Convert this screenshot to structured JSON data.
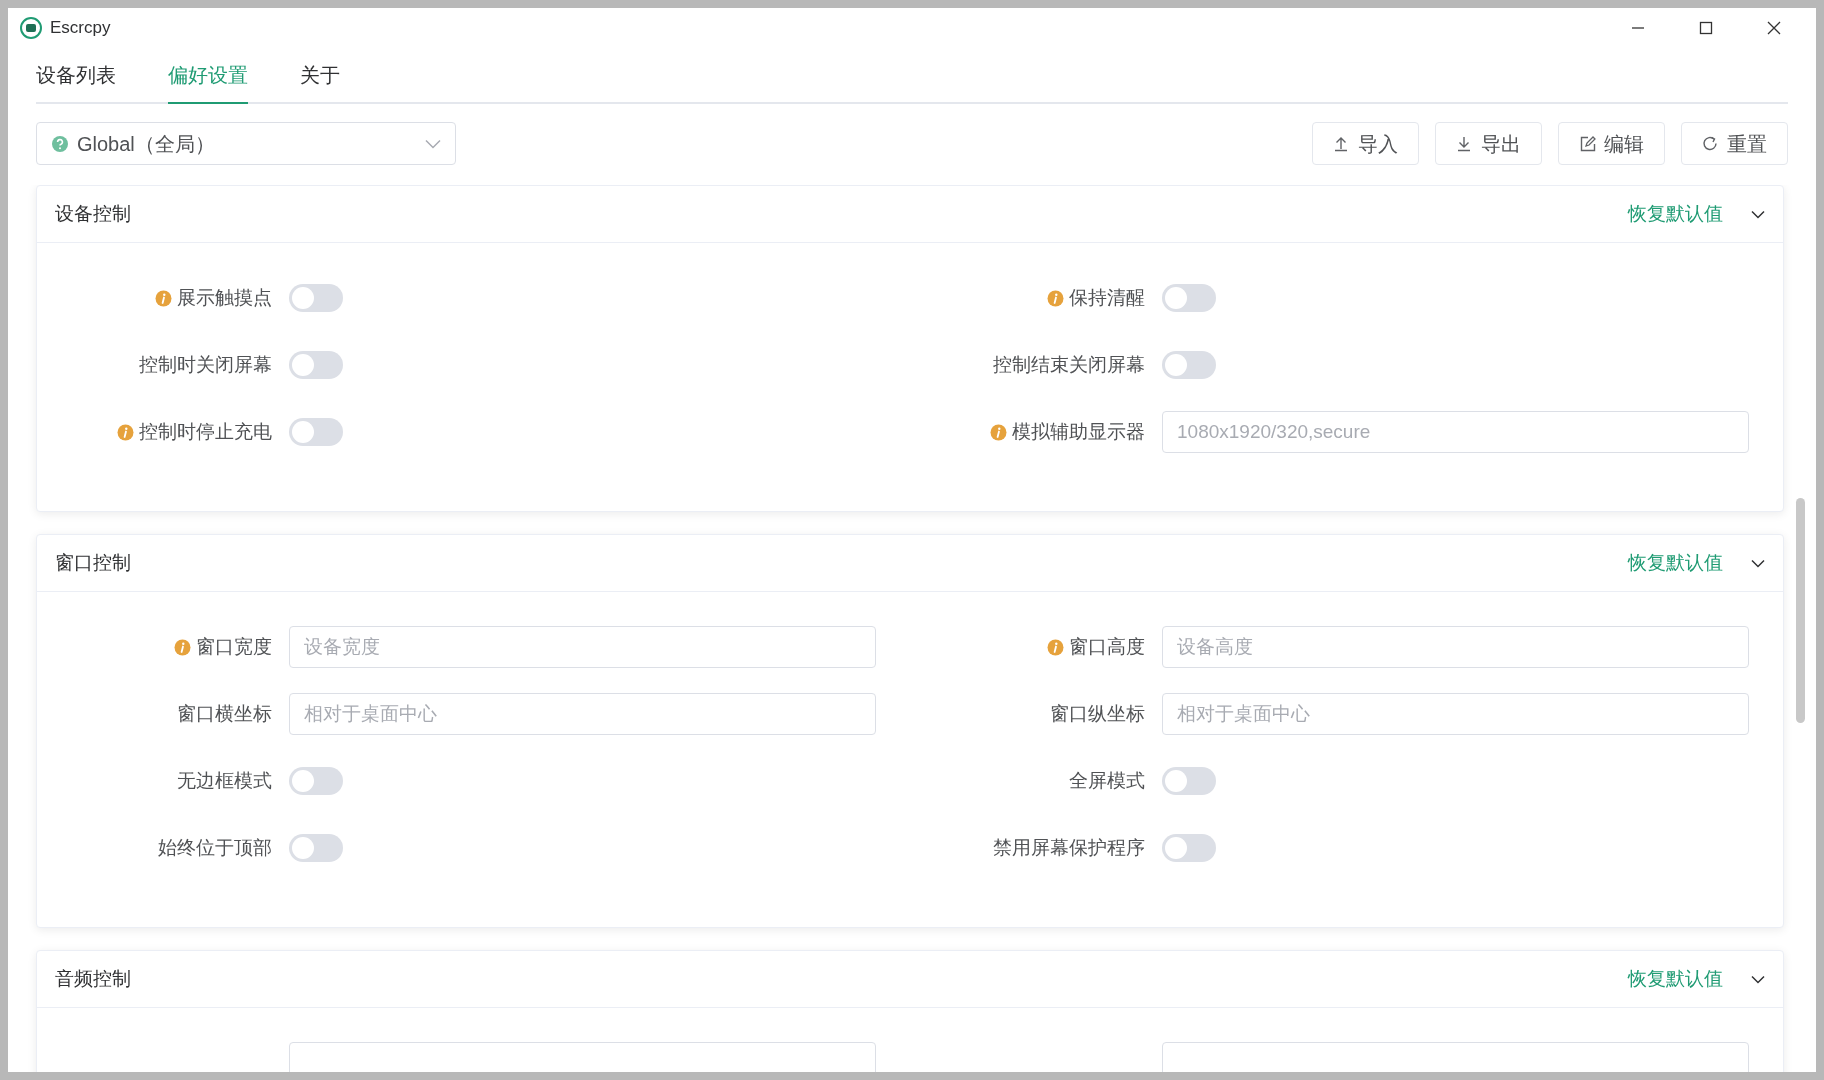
{
  "window": {
    "title": "Escrcpy"
  },
  "tabs": [
    {
      "label": "设备列表",
      "selected": false
    },
    {
      "label": "偏好设置",
      "selected": true
    },
    {
      "label": "关于",
      "selected": false
    }
  ],
  "scope_select": {
    "value": "Global（全局）"
  },
  "toolbar_buttons": [
    {
      "kind": "import",
      "label": "导入"
    },
    {
      "kind": "export",
      "label": "导出"
    },
    {
      "kind": "edit",
      "label": "编辑"
    },
    {
      "kind": "reset",
      "label": "重置"
    }
  ],
  "sections": [
    {
      "title": "设备控制",
      "reset_label": "恢复默认值",
      "items": [
        {
          "kind": "switch",
          "label": "展示触摸点",
          "info": true,
          "on": false
        },
        {
          "kind": "switch",
          "label": "保持清醒",
          "info": true,
          "on": false
        },
        {
          "kind": "switch",
          "label": "控制时关闭屏幕",
          "info": false,
          "on": false
        },
        {
          "kind": "switch",
          "label": "控制结束关闭屏幕",
          "info": false,
          "on": false
        },
        {
          "kind": "switch",
          "label": "控制时停止充电",
          "info": true,
          "on": false
        },
        {
          "kind": "input",
          "label": "模拟辅助显示器",
          "info": true,
          "placeholder": "1080x1920/320,secure"
        }
      ]
    },
    {
      "title": "窗口控制",
      "reset_label": "恢复默认值",
      "items": [
        {
          "kind": "input",
          "label": "窗口宽度",
          "info": true,
          "placeholder": "设备宽度"
        },
        {
          "kind": "input",
          "label": "窗口高度",
          "info": true,
          "placeholder": "设备高度"
        },
        {
          "kind": "input",
          "label": "窗口横坐标",
          "info": false,
          "placeholder": "相对于桌面中心"
        },
        {
          "kind": "input",
          "label": "窗口纵坐标",
          "info": false,
          "placeholder": "相对于桌面中心"
        },
        {
          "kind": "switch",
          "label": "无边框模式",
          "info": false,
          "on": false
        },
        {
          "kind": "switch",
          "label": "全屏模式",
          "info": false,
          "on": false
        },
        {
          "kind": "switch",
          "label": "始终位于顶部",
          "info": false,
          "on": false
        },
        {
          "kind": "switch",
          "label": "禁用屏幕保护程序",
          "info": false,
          "on": false
        }
      ]
    },
    {
      "title": "音频控制",
      "reset_label": "恢复默认值",
      "items": [
        {
          "kind": "input",
          "info": false
        },
        {
          "kind": "input",
          "info": false
        }
      ]
    }
  ]
}
